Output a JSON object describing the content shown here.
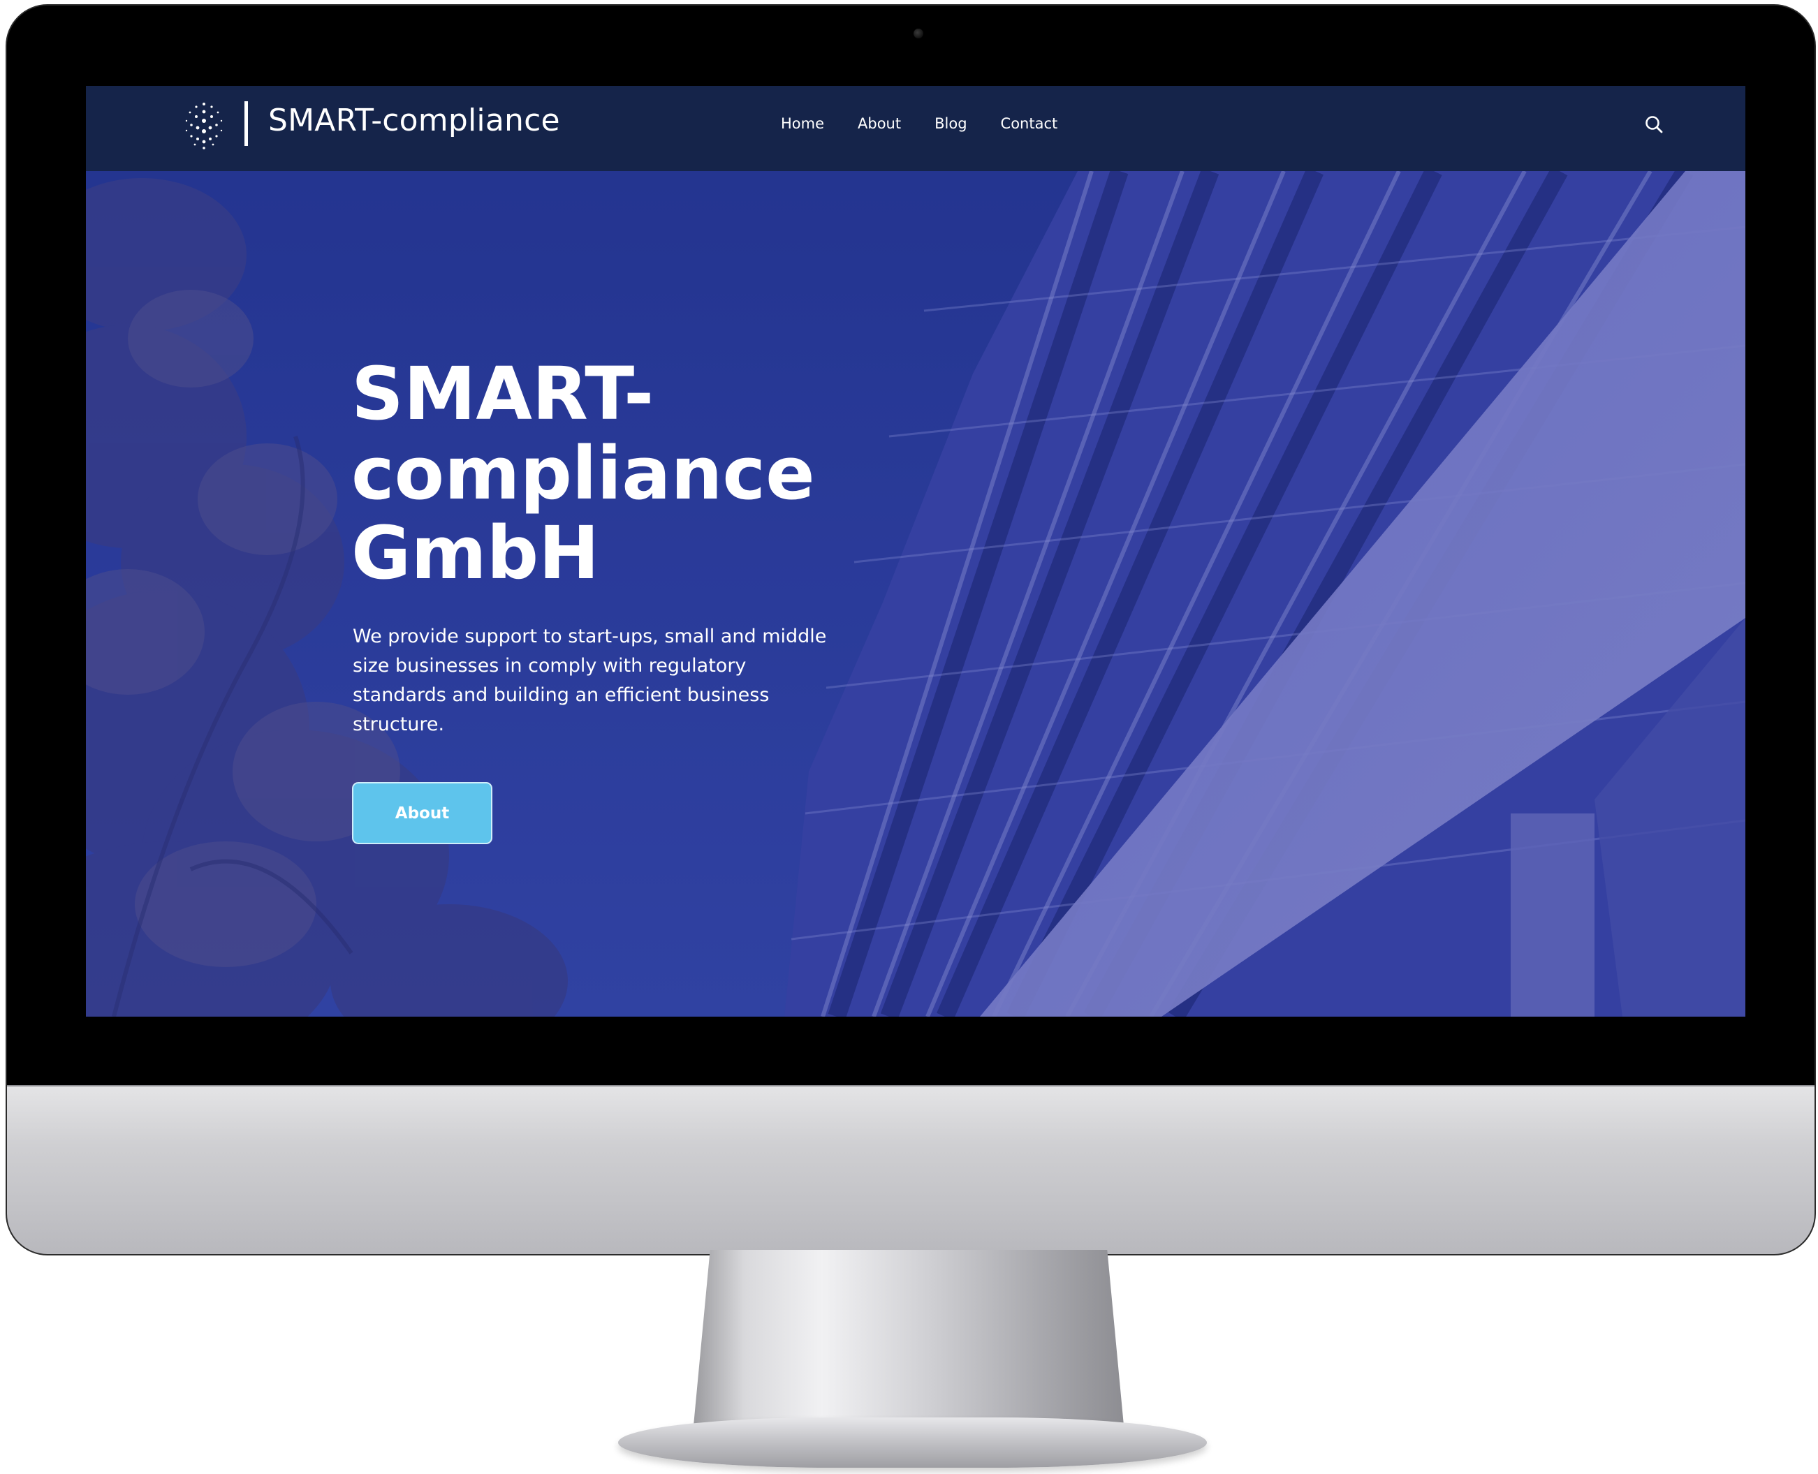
{
  "site": {
    "brand": "SMART-compliance",
    "logo_icon": "dot-sphere-logo-icon",
    "search_icon": "search-icon"
  },
  "nav": {
    "items": [
      {
        "label": "Home"
      },
      {
        "label": "About"
      },
      {
        "label": "Blog"
      },
      {
        "label": "Contact"
      }
    ]
  },
  "hero": {
    "title": "SMART-compliance GmbH",
    "description": "We provide support to start-ups, small and middle size businesses in comply with regulatory standards and building an efficient business structure.",
    "button_label": "About"
  },
  "colors": {
    "navbar": "#15244a",
    "hero_blue": "#2c3e9a",
    "button": "#5ec4ec",
    "text": "#ffffff"
  }
}
